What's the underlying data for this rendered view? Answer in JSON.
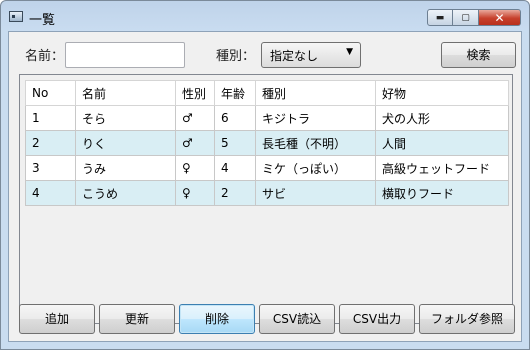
{
  "window": {
    "title": "一覧",
    "minimize": "▬",
    "maximize": "▢",
    "close": "✕"
  },
  "filter": {
    "name_label": "名前：",
    "name_value": "",
    "type_label": "種別：",
    "type_selected": "指定なし",
    "search_label": "検索"
  },
  "table": {
    "headers": [
      "No",
      "名前",
      "性別",
      "年齢",
      "種別",
      "好物"
    ],
    "rows": [
      [
        "1",
        "そら",
        "♂",
        "6",
        "キジトラ",
        "犬の人形"
      ],
      [
        "2",
        "りく",
        "♂",
        "5",
        "長毛種（不明）",
        "人間"
      ],
      [
        "3",
        "うみ",
        "♀",
        "4",
        "ミケ（っぽい）",
        "高級ウェットフード"
      ],
      [
        "4",
        "こうめ",
        "♀",
        "2",
        "サビ",
        "横取りフード"
      ]
    ]
  },
  "buttons": {
    "add": "追加",
    "update": "更新",
    "delete": "削除",
    "csv_read": "CSV読込",
    "csv_out": "CSV出力",
    "folder": "フォルダ参照"
  },
  "colors": {
    "row_alt": "#d9eef4",
    "accent": "#3c7fb1"
  }
}
